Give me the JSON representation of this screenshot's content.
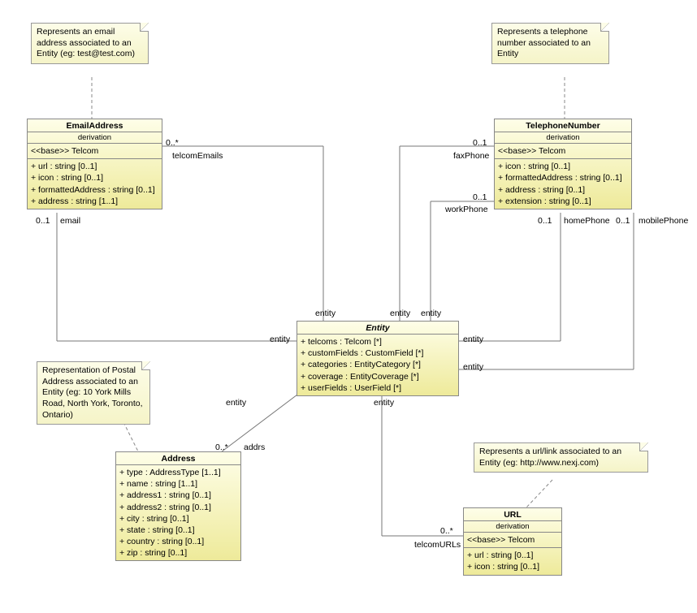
{
  "notes": {
    "emailNote": "Represents an email address associated to an Entity (eg: test@test.com)",
    "telephoneNote": "Represents a telephone number associated to an Entity",
    "addressNote": "Representation of Postal Address associated to an Entity (eg: 10 York Mills Road, North York, Toronto, Ontario)",
    "urlNote": "Represents a url/link associated to an Entity (eg: http://www.nexj.com)"
  },
  "classes": {
    "emailAddress": {
      "name": "EmailAddress",
      "subtitle": "derivation",
      "base": "<<base>> Telcom",
      "attrs": [
        "+ url : string [0..1]",
        "+ icon : string [0..1]",
        "+ formattedAddress : string [0..1]",
        "+ address : string [1..1]"
      ]
    },
    "telephoneNumber": {
      "name": "TelephoneNumber",
      "subtitle": "derivation",
      "base": "<<base>> Telcom",
      "attrs": [
        "+ icon : string [0..1]",
        "+ formattedAddress : string [0..1]",
        "+ address : string [0..1]",
        "+ extension : string [0..1]"
      ]
    },
    "entity": {
      "name": "Entity",
      "attrs": [
        "+ telcoms : Telcom [*]",
        "+ customFields : CustomField [*]",
        "+ categories : EntityCategory [*]",
        "+ coverage : EntityCoverage [*]",
        "+ userFields : UserField [*]"
      ]
    },
    "address": {
      "name": "Address",
      "attrs": [
        "+ type : AddressType [1..1]",
        "+ name : string [1..1]",
        "+ address1 : string [0..1]",
        "+ address2 : string [0..1]",
        "+ city : string [0..1]",
        "+ state : string [0..1]",
        "+ country : string [0..1]",
        "+ zip : string [0..1]"
      ]
    },
    "url": {
      "name": "URL",
      "subtitle": "derivation",
      "base": "<<base>> Telcom",
      "attrs": [
        "+ url : string [0..1]",
        "+ icon : string [0..1]"
      ]
    }
  },
  "labels": {
    "zeroStar": "0..*",
    "zeroOne": "0..1",
    "telcomEmails": "telcomEmails",
    "email": "email",
    "faxPhone": "faxPhone",
    "workPhone": "workPhone",
    "homePhone": "homePhone",
    "mobilePhone": "mobilePhone",
    "entity": "entity",
    "addrs": "addrs",
    "telcomURLs": "telcomURLs"
  }
}
